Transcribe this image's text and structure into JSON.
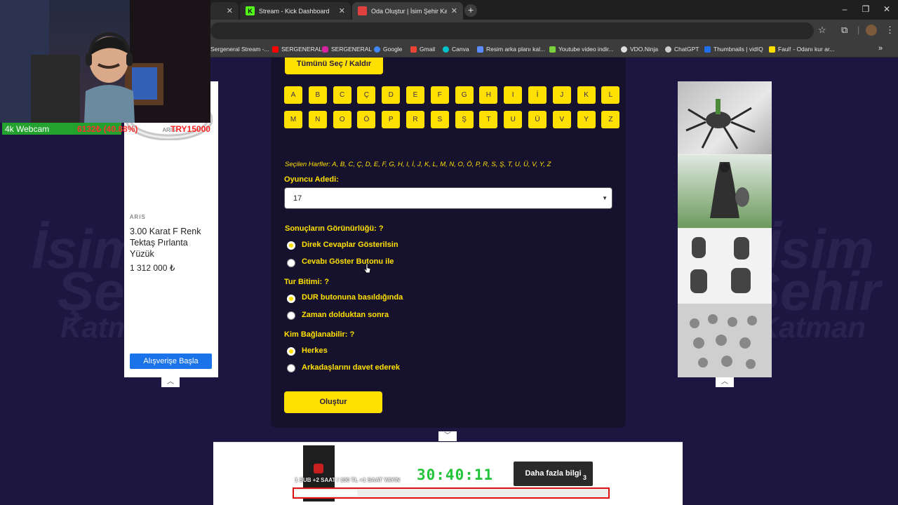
{
  "browser": {
    "tabs": [
      {
        "title": "",
        "active": false
      },
      {
        "title": "Stream - Kick Dashboard",
        "active": false
      },
      {
        "title": "Oda Oluştur | İsim Şehir Katman",
        "active": true
      }
    ],
    "bookmarks": [
      "Sergeneral Stream -...",
      "SERGENERAL",
      "SERGENERAL",
      "Google",
      "Gmail",
      "Canva",
      "Resim arka planı kal...",
      "Youtube video indir...",
      "VDO.Ninja",
      "ChatGPT",
      "Thumbnails | vidIQ",
      "Faul! - Odanı kur ar..."
    ]
  },
  "form": {
    "select_all_label": "Tümünü Seç / Kaldır",
    "letters": [
      "A",
      "B",
      "C",
      "Ç",
      "D",
      "E",
      "F",
      "G",
      "H",
      "I",
      "İ",
      "J",
      "K",
      "L",
      "M",
      "N",
      "O",
      "Ö",
      "P",
      "R",
      "S",
      "Ş",
      "T",
      "U",
      "Ü",
      "V",
      "Y",
      "Z"
    ],
    "selected_letters": "Seçilen Harfler: A, B, C, Ç, D, E, F, G, H, I, İ, J, K, L, M, N, O, Ö, P, R, S, Ş, T, U, Ü, V, Y, Z",
    "player_count_label": "Oyuncu Adedi:",
    "player_count_value": "17",
    "visibility": {
      "label": "Sonuçların Görünürlüğü:  ?",
      "options": [
        {
          "label": "Direk Cevaplar Gösterilsin",
          "selected": true
        },
        {
          "label": "Cevabı Göster Butonu ile",
          "selected": false
        }
      ]
    },
    "round_end": {
      "label": "Tur Bitimi:  ?",
      "options": [
        {
          "label": "DUR butonuna basıldığında",
          "selected": true
        },
        {
          "label": "Zaman dolduktan sonra",
          "selected": false
        }
      ]
    },
    "who_can_join": {
      "label": "Kim Bağlanabilir:  ?",
      "options": [
        {
          "label": "Herkes",
          "selected": true
        },
        {
          "label": "Arkadaşlarını davet ederek",
          "selected": false
        }
      ]
    },
    "create_label": "Oluştur"
  },
  "ad_left": {
    "brand": "ARIS",
    "ring_engraving": "ARIS",
    "title": "3.00 Karat F Renk Tektaş Pırlanta Yüzük",
    "price": "1 312 000 ₺",
    "cta": "Alışverişe Başla"
  },
  "webcam": {
    "label": "4k Webcam",
    "stats": "6132₺ (40.88%)",
    "price": "TRY15000"
  },
  "stream_overlay": {
    "timer": "30:40:11",
    "info_button": "Daha fazla bilgi",
    "info_badge": "3",
    "ticker": "1 SUB +2 SAAT / 100 TL +1 SAAT YAYIN",
    "progress": 0.2
  },
  "background_words": [
    "İsim",
    "Şehir",
    "Katman"
  ],
  "colors": {
    "accent": "#ffe000",
    "page_bg": "#1c1640",
    "timer": "#22c53a",
    "progress_border": "#e01010"
  }
}
